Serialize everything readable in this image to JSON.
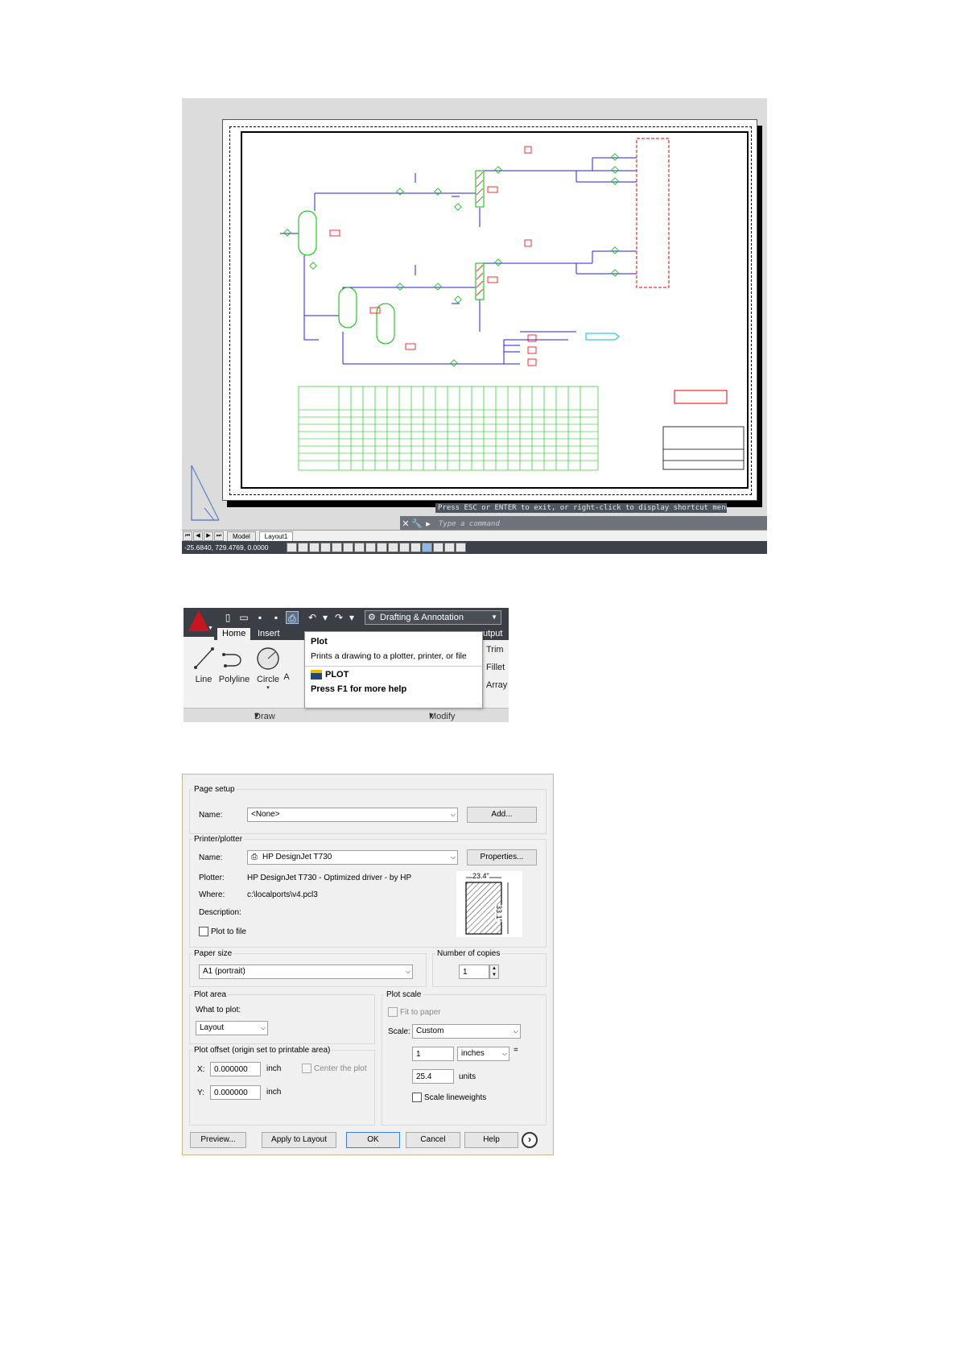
{
  "drawing": {
    "command_prompt": "Press ESC or ENTER to exit, or right-click to display shortcut menu.",
    "command_placeholder": "Type a command",
    "layout_tabs": [
      "Model",
      "Layout1"
    ],
    "coordinates": "-25.6840, 729.4769, 0.0000",
    "colors": {
      "process": "#2222dd",
      "equipment": "#00bb00",
      "tag": "#ee0000",
      "power": "#00bbee"
    }
  },
  "ribbon": {
    "workspace": "Drafting & Annotation",
    "tabs": [
      "Home",
      "Insert",
      "utput"
    ],
    "draw_tools": [
      "Line",
      "Polyline",
      "Circle",
      "A"
    ],
    "draw_panel_label": "Draw",
    "modify_panel_label": "Modify",
    "modify_tools": [
      "Trim",
      "Fillet",
      "Array"
    ],
    "tooltip": {
      "title": "Plot",
      "description": "Prints a drawing to a plotter, printer, or file",
      "command": "PLOT",
      "help": "Press F1 for more help"
    }
  },
  "plot_dialog": {
    "page_setup": {
      "label": "Page setup",
      "name_label": "Name:",
      "name_value": "<None>",
      "add_button": "Add..."
    },
    "printer": {
      "label": "Printer/plotter",
      "name_label": "Name:",
      "name_value": "HP DesignJet T730",
      "properties_button": "Properties...",
      "plotter_label": "Plotter:",
      "plotter_value": "HP DesignJet T730 - Optimized driver - by HP",
      "where_label": "Where:",
      "where_value": "c:\\localports\\v4.pcl3",
      "description_label": "Description:",
      "plot_to_file": "Plot to file",
      "paper_width": "23.4\"",
      "paper_height": "33.1\""
    },
    "paper_size": {
      "label": "Paper size",
      "value": "A1 (portrait)"
    },
    "copies": {
      "label": "Number of copies",
      "value": "1"
    },
    "plot_area": {
      "label": "Plot area",
      "what_label": "What to plot:",
      "what_value": "Layout"
    },
    "plot_offset": {
      "label": "Plot offset (origin set to printable area)",
      "x_label": "X:",
      "x_value": "0.000000",
      "x_unit": "inch",
      "y_label": "Y:",
      "y_value": "0.000000",
      "y_unit": "inch",
      "center": "Center the plot"
    },
    "plot_scale": {
      "label": "Plot scale",
      "fit": "Fit to paper",
      "scale_label": "Scale:",
      "scale_value": "Custom",
      "value1": "1",
      "unit1": "inches",
      "equals": "=",
      "value2": "25.4",
      "unit2": "units",
      "lineweights": "Scale lineweights"
    },
    "buttons": {
      "preview": "Preview...",
      "apply": "Apply to Layout",
      "ok": "OK",
      "cancel": "Cancel",
      "help": "Help"
    }
  }
}
